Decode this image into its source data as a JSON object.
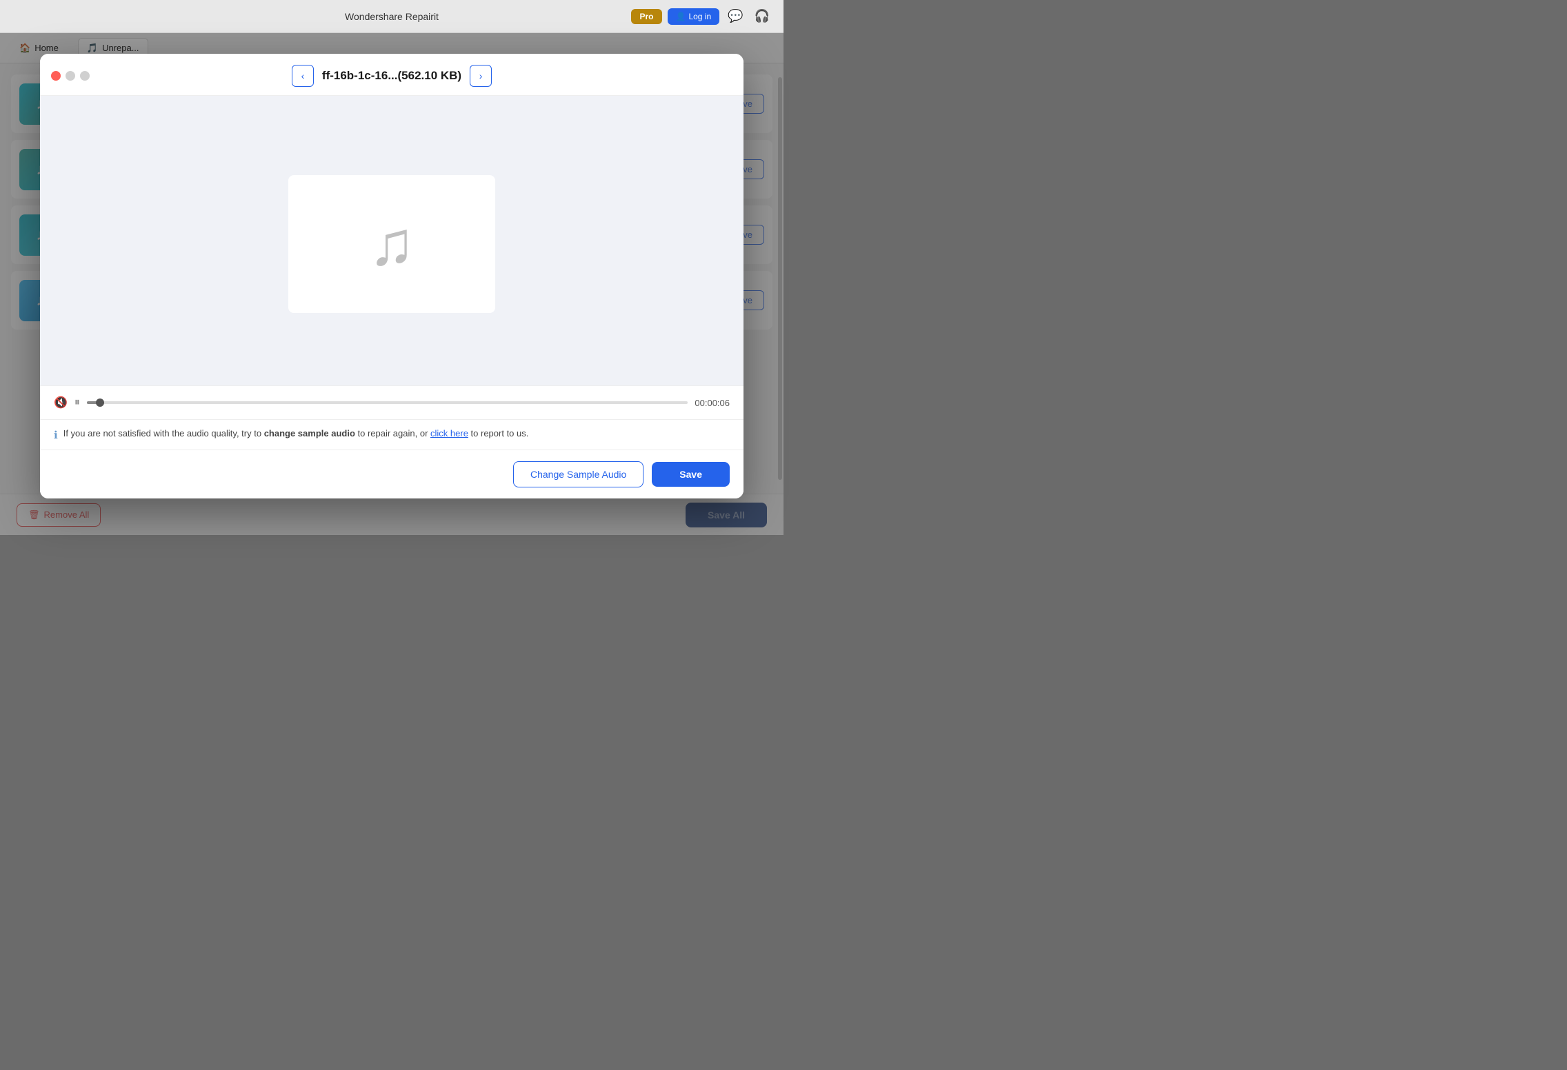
{
  "app": {
    "title": "Wondershare Repairit",
    "pro_label": "Pro",
    "login_label": "Log in"
  },
  "nav": {
    "home_label": "Home",
    "unrepaired_label": "Unrepa..."
  },
  "background": {
    "list_items": [
      {
        "id": 1
      },
      {
        "id": 2
      },
      {
        "id": 3
      },
      {
        "id": 4
      }
    ],
    "save_label": "Save",
    "remove_all_label": "Remove All",
    "save_all_label": "Save All"
  },
  "modal": {
    "filename": "ff-16b-1c-16...(562.10 KB)",
    "nav_prev_label": "<",
    "nav_next_label": ">",
    "duration": "00:00:06",
    "info_text_prefix": "If you are not satisfied with the audio quality, try to ",
    "info_bold": "change sample audio",
    "info_text_mid": " to repair again, or ",
    "info_link": "click here",
    "info_text_suffix": " to report to us.",
    "change_sample_label": "Change Sample Audio",
    "save_label": "Save"
  }
}
